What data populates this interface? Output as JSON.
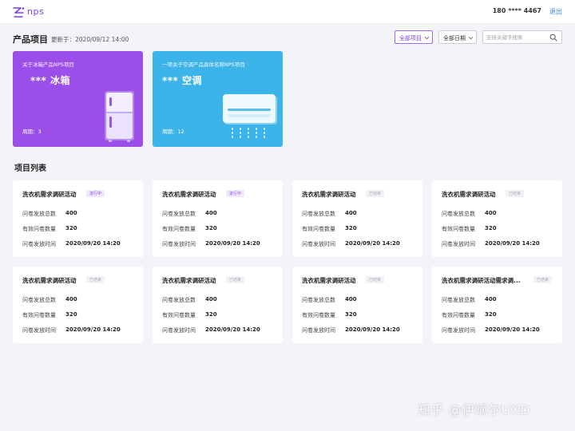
{
  "topbar": {
    "logo_text": "nps",
    "phone": "180 **** 4467",
    "logout": "退出"
  },
  "header": {
    "title": "产品项目",
    "updated": "更新于：2020/09/12 14:00",
    "project_filter": "全部项目",
    "date_filter": "全部日期",
    "search_placeholder": "支持关键字搜索"
  },
  "featured": [
    {
      "subtitle": "关于冰箱产品NPS项目",
      "title": "*** 冰箱",
      "cycle": "周期：3"
    },
    {
      "subtitle": "一项关于空调产品具体名称NPS项目",
      "title": "*** 空调",
      "cycle": "周期：12"
    }
  ],
  "section_title": "项目列表",
  "labels": {
    "total": "问卷发放总数",
    "valid": "有效问卷数量",
    "time": "问卷发放时间"
  },
  "cards": [
    {
      "title": "洗衣机需求调研活动",
      "status": "进行中",
      "total": "400",
      "valid": "320",
      "time": "2020/09/20 14:20"
    },
    {
      "title": "洗衣机需求调研活动",
      "status": "进行中",
      "total": "400",
      "valid": "320",
      "time": "2020/09/20 14:20"
    },
    {
      "title": "洗衣机需求调研活动",
      "status": "已结束",
      "total": "400",
      "valid": "320",
      "time": "2020/09/20 14:20"
    },
    {
      "title": "洗衣机需求调研活动",
      "status": "已结束",
      "total": "400",
      "valid": "320",
      "time": "2020/09/20 14:20"
    },
    {
      "title": "洗衣机需求调研活动",
      "status": "已结束",
      "total": "400",
      "valid": "320",
      "time": "2020/09/20 14:20"
    },
    {
      "title": "洗衣机需求调研活动",
      "status": "已结束",
      "total": "400",
      "valid": "320",
      "time": "2020/09/20 14:20"
    },
    {
      "title": "洗衣机需求调研活动",
      "status": "已结束",
      "total": "400",
      "valid": "320",
      "time": "2020/09/20 14:20"
    },
    {
      "title": "洗衣机需求调研活动需求调...",
      "status": "已结束",
      "total": "400",
      "valid": "320",
      "time": "2020/09/20 14:20"
    }
  ],
  "watermark": "知乎 @伊飒尔UXD",
  "colors": {
    "brand": "#7a3fe4",
    "fridge_card": "#9b4ee8",
    "ac_card": "#3cb4ea",
    "link": "#3b82f6"
  },
  "icons": [
    "nps-logo-icon",
    "search-icon",
    "fridge-icon",
    "air-conditioner-icon",
    "chevron-down-icon"
  ]
}
